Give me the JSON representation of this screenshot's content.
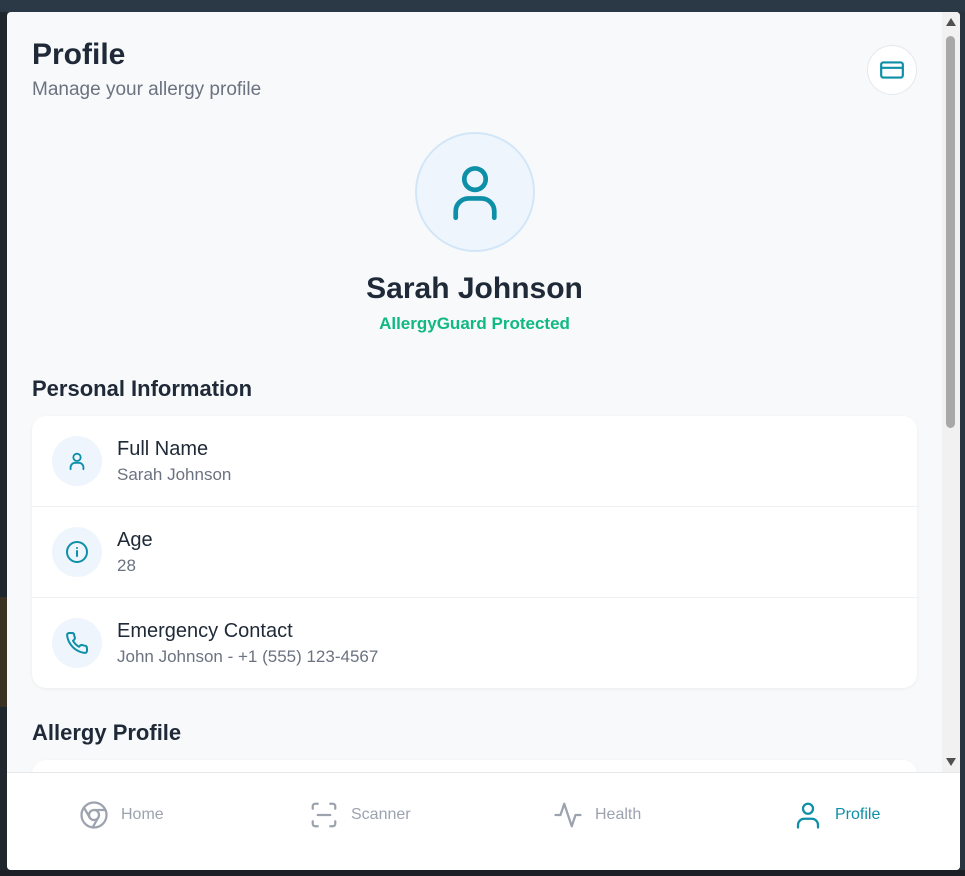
{
  "header": {
    "title": "Profile",
    "subtitle": "Manage your allergy profile",
    "card_button_icon": "credit-card-icon"
  },
  "user": {
    "avatar_icon": "user-icon",
    "name": "Sarah Johnson",
    "status": "AllergyGuard Protected"
  },
  "sections": {
    "personal": "Personal Information",
    "allergy": "Allergy Profile"
  },
  "personal_info": [
    {
      "icon": "user-icon",
      "label": "Full Name",
      "value": "Sarah Johnson"
    },
    {
      "icon": "info-icon",
      "label": "Age",
      "value": "28"
    },
    {
      "icon": "phone-icon",
      "label": "Emergency Contact",
      "value": "John Johnson - +1 (555) 123-4567"
    }
  ],
  "nav": [
    {
      "icon": "home-icon",
      "label": "Home",
      "active": false
    },
    {
      "icon": "scanner-icon",
      "label": "Scanner",
      "active": false
    },
    {
      "icon": "health-icon",
      "label": "Health",
      "active": false
    },
    {
      "icon": "user-icon",
      "label": "Profile",
      "active": true
    }
  ],
  "colors": {
    "accent": "#0e8fa8",
    "success": "#10b981",
    "text": "#1f2937",
    "muted": "#6b7280",
    "nav_inactive": "#9ca3af"
  }
}
